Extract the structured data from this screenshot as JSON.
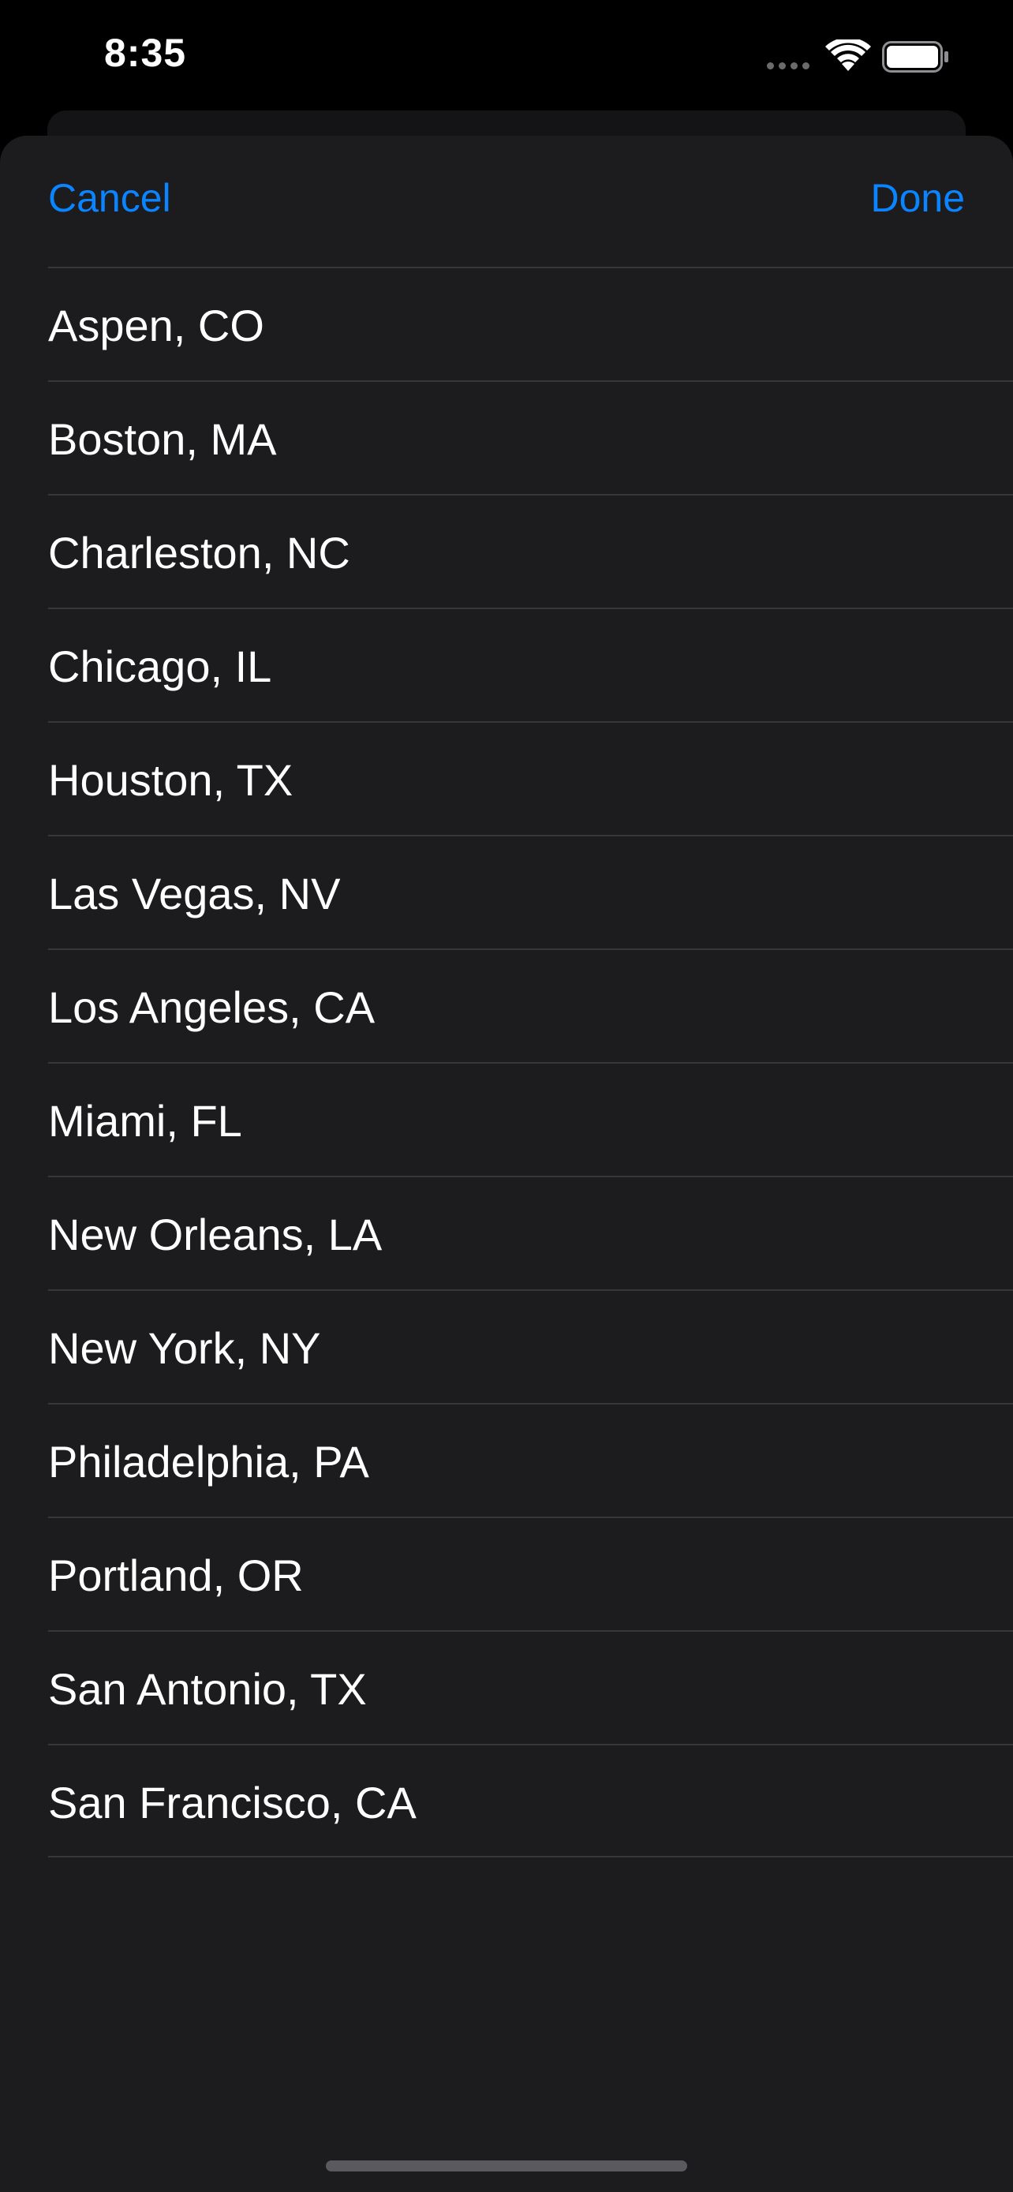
{
  "status_bar": {
    "time": "8:35",
    "wifi_icon": "wifi-icon",
    "battery_icon": "battery-icon"
  },
  "nav": {
    "cancel_label": "Cancel",
    "done_label": "Done"
  },
  "cities": [
    "Aspen, CO",
    "Boston, MA",
    "Charleston, NC",
    "Chicago, IL",
    "Houston, TX",
    "Las Vegas, NV",
    "Los Angeles, CA",
    "Miami, FL",
    "New Orleans, LA",
    "New York, NY",
    "Philadelphia, PA",
    "Portland, OR",
    "San Antonio, TX",
    "San Francisco, CA"
  ],
  "colors": {
    "accent": "#0a84ff",
    "sheet_background": "#1c1c1e",
    "separator": "#38383a"
  }
}
